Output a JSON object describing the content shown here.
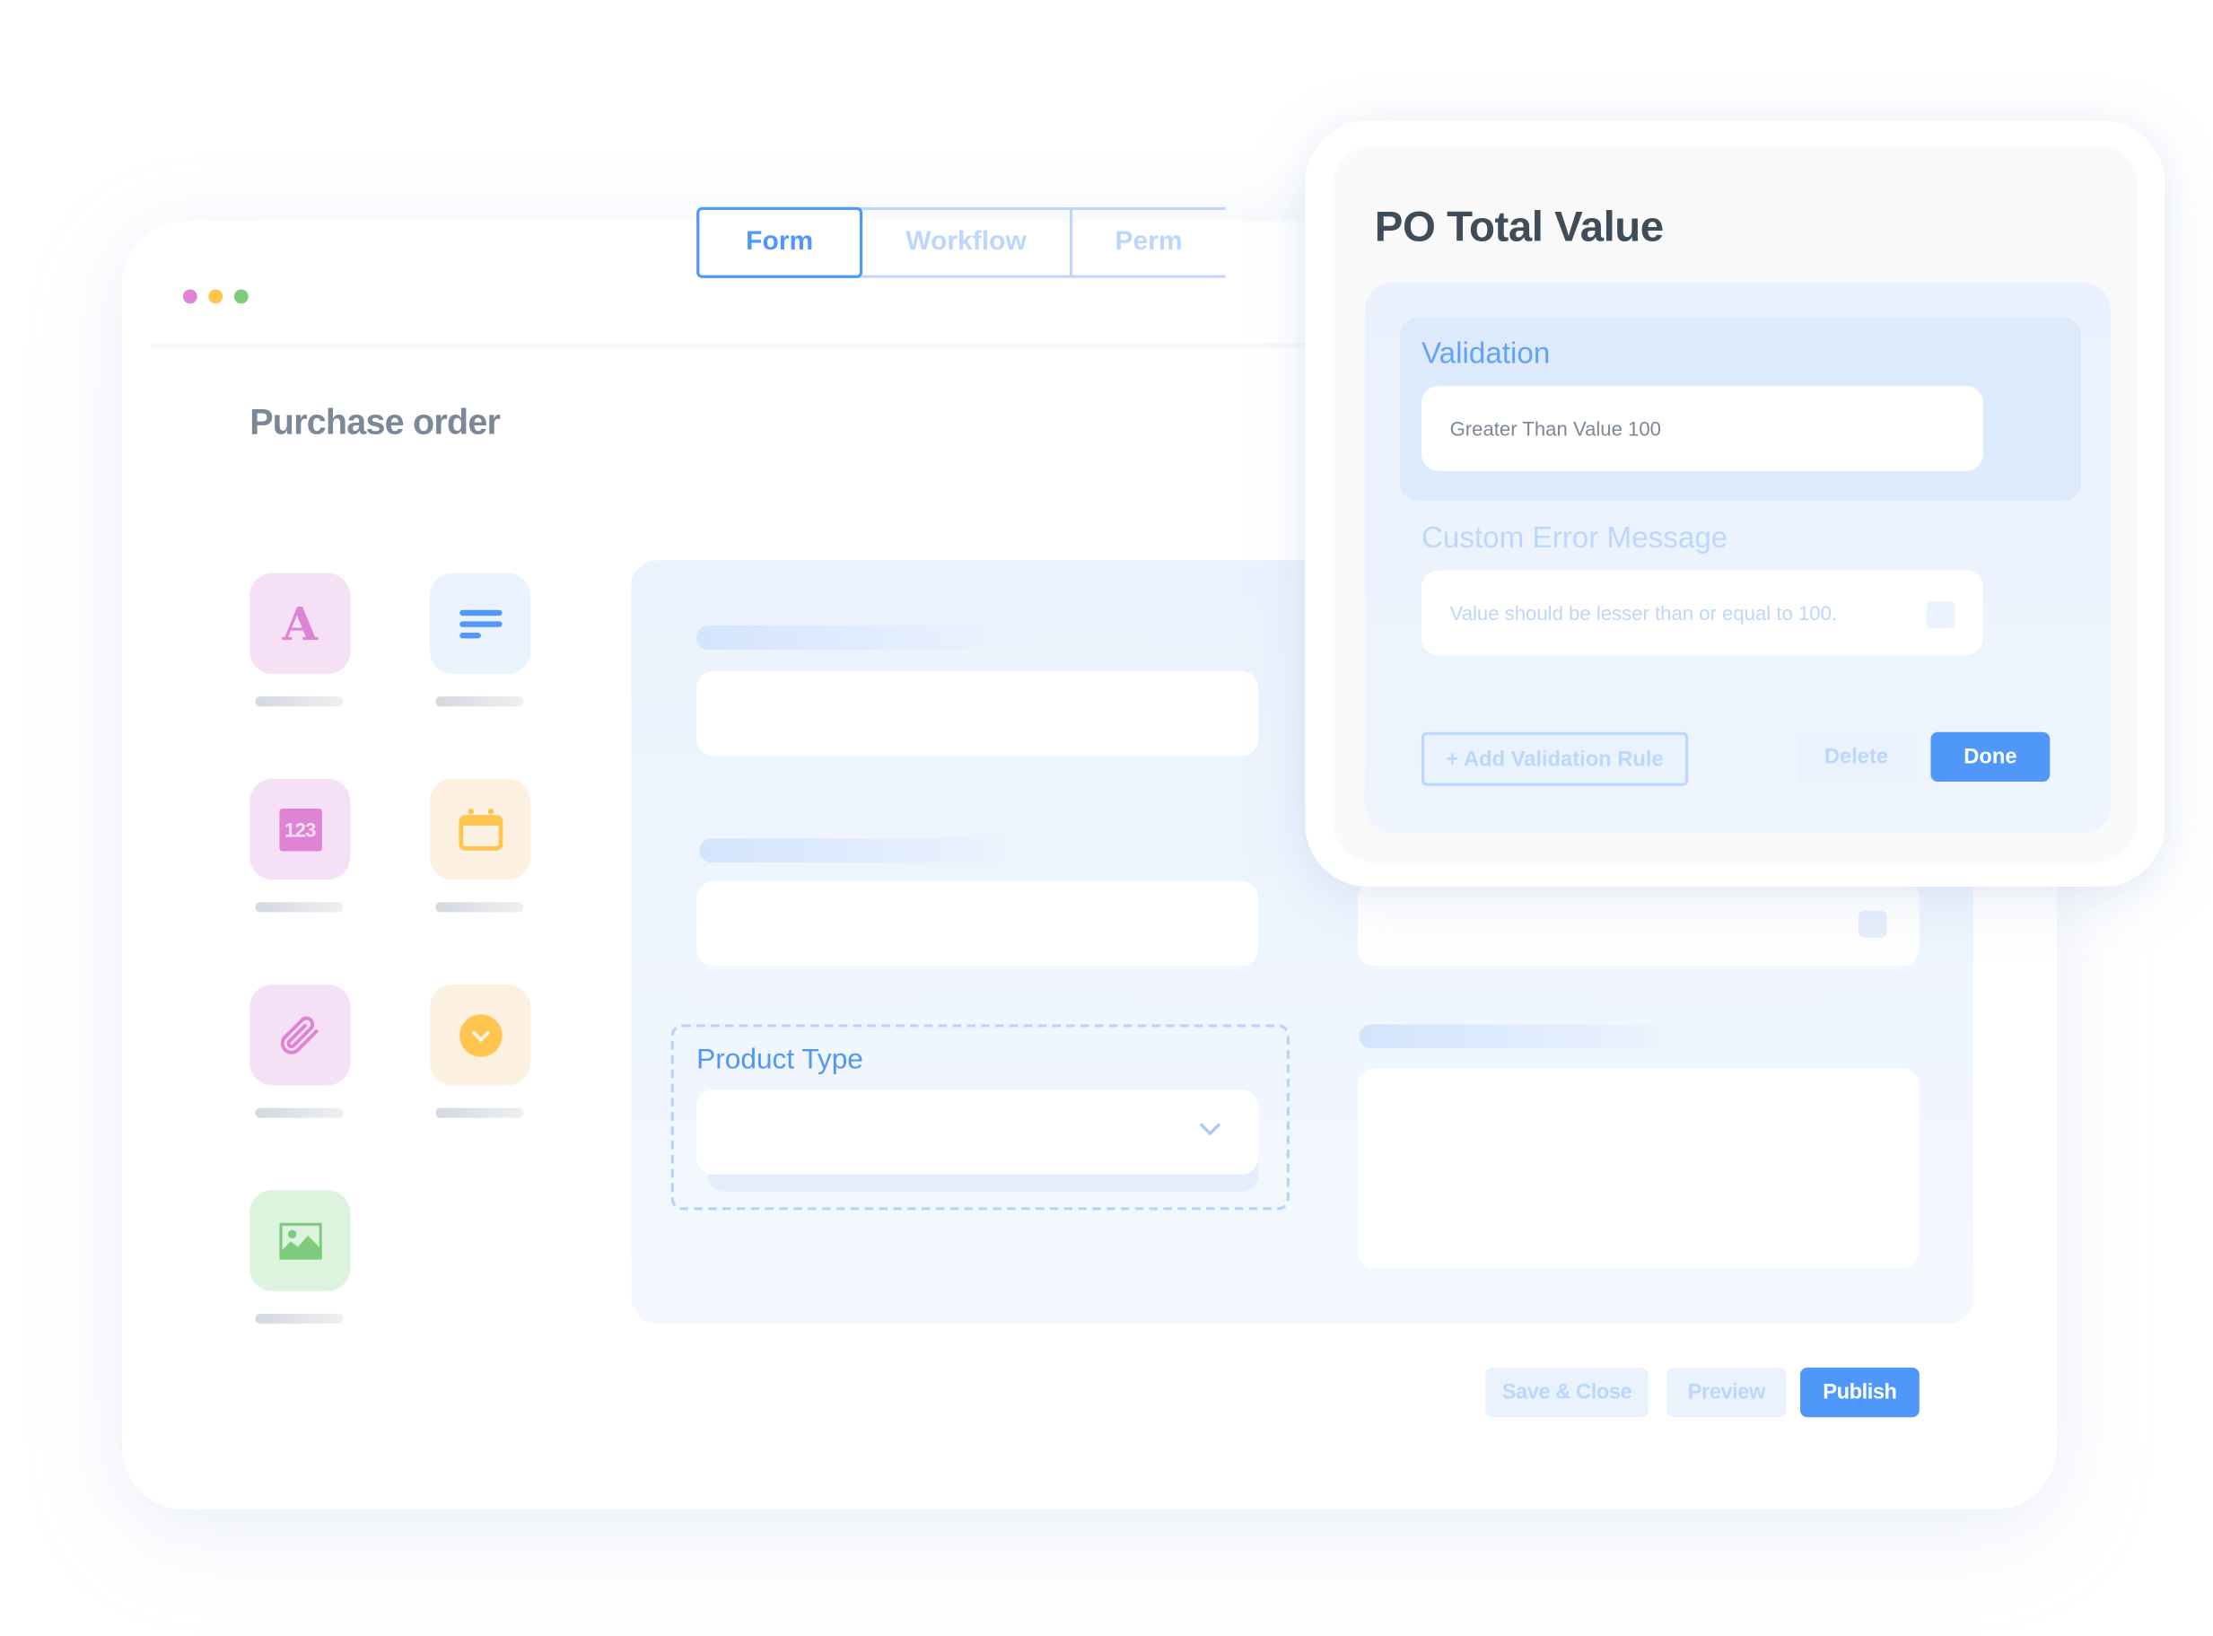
{
  "window": {
    "title": "Purchase order",
    "traffic_lights": [
      {
        "name": "close",
        "color": "#e184d4"
      },
      {
        "name": "minimize",
        "color": "#ffc54f"
      },
      {
        "name": "maximize",
        "color": "#7fcb7c"
      }
    ]
  },
  "tabs": [
    {
      "label": "Form",
      "active": true
    },
    {
      "label": "Workflow",
      "active": false
    },
    {
      "label": "Perm",
      "active": false
    }
  ],
  "palette": [
    {
      "icon": "text-field-icon",
      "glyph": "A",
      "bg": "#f6e0f6",
      "fg": "#df84d4"
    },
    {
      "icon": "multiline-text-icon",
      "glyph": "",
      "bg": "#eaf2fd",
      "fg": "#4f97f8"
    },
    {
      "icon": "number-field-icon",
      "glyph": "123",
      "bg": "#f6e0f6",
      "fg": "#df84d4"
    },
    {
      "icon": "date-field-icon",
      "glyph": "",
      "bg": "#fcf0e1",
      "fg": "#ffc54f"
    },
    {
      "icon": "attachment-icon",
      "glyph": "",
      "bg": "#f6e0f6",
      "fg": "#df84d4"
    },
    {
      "icon": "dropdown-field-icon",
      "glyph": "",
      "bg": "#fcf0e1",
      "fg": "#ffc54f"
    },
    {
      "icon": "image-field-icon",
      "glyph": "",
      "bg": "#dcf3de",
      "fg": "#7fcb7c"
    }
  ],
  "canvas": {
    "product_type_label": "Product Type",
    "product_type_value": ""
  },
  "footer": {
    "save_close": "Save & Close",
    "preview": "Preview",
    "publish": "Publish"
  },
  "popup": {
    "title": "PO Total Value",
    "validation_label": "Validation",
    "validation_value": "Greater Than Value 100",
    "error_label": "Custom Error Message",
    "error_value": "Value should be lesser than or equal to 100.",
    "add_rule": "+ Add Validation Rule",
    "delete": "Delete",
    "done": "Done"
  },
  "colors": {
    "accent": "#4f97f8",
    "accent_light": "#bcd7fb",
    "title_text": "#3f4c5a"
  }
}
